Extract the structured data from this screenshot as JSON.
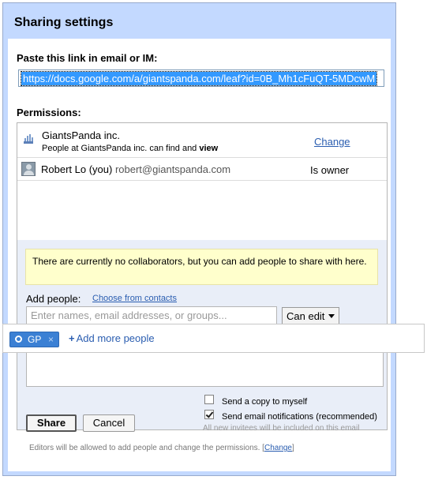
{
  "dialog": {
    "title": "Sharing settings",
    "link_label": "Paste this link in email or IM:",
    "link_value": "https://docs.google.com/a/giantspanda.com/leaf?id=0B_Mh1cFuQT-5MDcwM",
    "permissions_label": "Permissions:"
  },
  "permissions": {
    "org": {
      "icon": "building-icon",
      "name": "GiantsPanda inc.",
      "desc_prefix": "People at GiantsPanda inc. can find and ",
      "desc_bold": "view",
      "change_label": "Change"
    },
    "owner": {
      "icon": "avatar-icon",
      "name": "Robert Lo (you)",
      "email": "robert@giantspanda.com",
      "role": "Is owner"
    }
  },
  "add": {
    "notice": "There are currently no collaborators, but you can add people to share with here.",
    "label": "Add people:",
    "contacts_link": "Choose from contacts",
    "input_placeholder": "Enter names, email addresses, or groups...",
    "permission_select": "Can edit"
  },
  "chips": {
    "chip_label": "GP",
    "chip_remove": "×",
    "add_more": "Add more people"
  },
  "options": {
    "copy_myself": "Send a copy to myself",
    "copy_myself_checked": false,
    "notify": "Send email notifications (recommended)",
    "notify_checked": true,
    "notify_hint": "All new invitees will be included on this email"
  },
  "buttons": {
    "share": "Share",
    "cancel": "Cancel"
  },
  "footer": {
    "note_prefix": "Editors will be allowed to add people and change the permissions.  [",
    "note_link": "Change",
    "note_suffix": "]"
  },
  "colors": {
    "dialog_bg": "#c3d9ff",
    "link": "#2a5db0",
    "notice_bg": "#ffffcc",
    "chip_bg": "#3b80d4"
  }
}
